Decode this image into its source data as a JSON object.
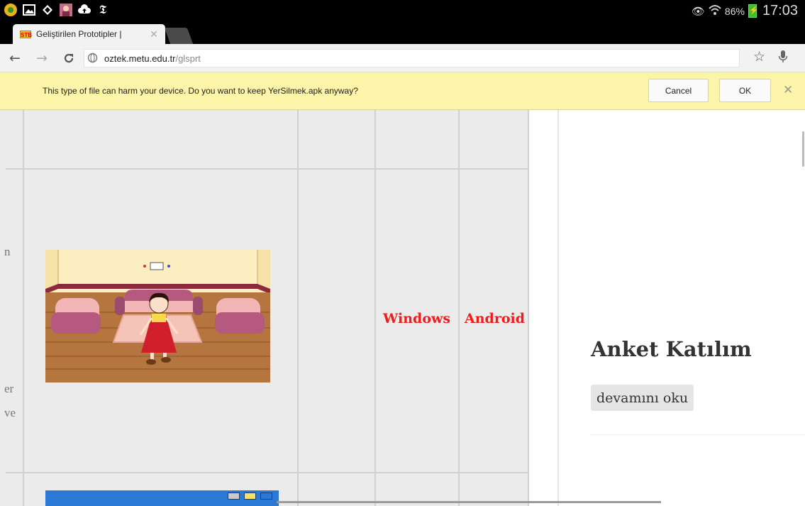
{
  "status_bar": {
    "icons": [
      "notification-app-icon",
      "gallery-icon",
      "store-icon",
      "avatar-app-icon",
      "cloud-upload-icon",
      "newspaper-icon"
    ],
    "battery_percent": "86%",
    "time": "17:03"
  },
  "tab": {
    "title": "Geliştirilen Prototipler |",
    "favicon": "STB"
  },
  "omnibox": {
    "host": "oztek.metu.edu.tr",
    "path": "/glsprt"
  },
  "infobar": {
    "message": "This type of file can harm your device. Do you want to keep YerSilmek.apk anyway?",
    "cancel_label": "Cancel",
    "ok_label": "OK"
  },
  "content": {
    "fragments": [
      "n",
      "er",
      "ve"
    ],
    "platforms": [
      "Windows",
      "Android"
    ],
    "accent_color": "#ee1c1c"
  },
  "sidebar": {
    "post_title": "Anket Katılım",
    "read_more": "devamını oku"
  }
}
